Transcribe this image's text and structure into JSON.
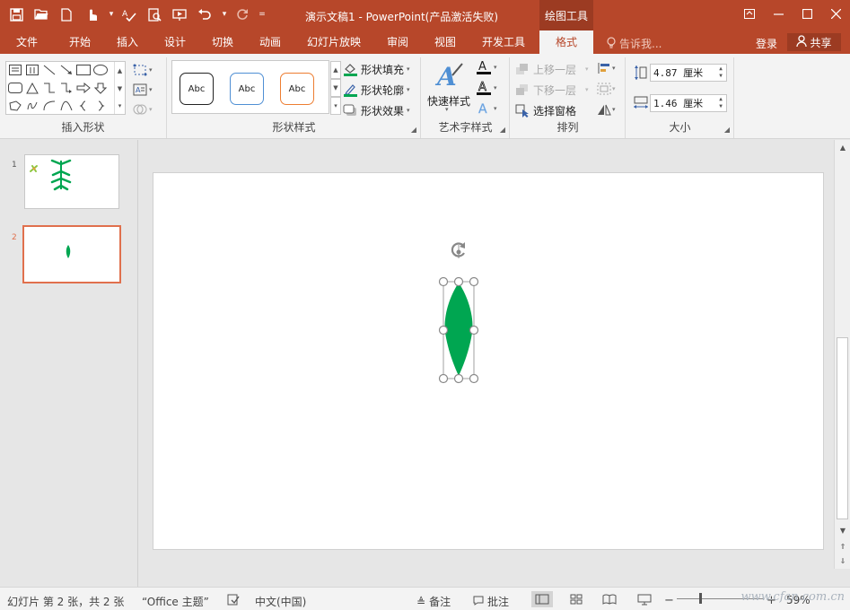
{
  "titlebar": {
    "doc_title": "演示文稿1 - PowerPoint(产品激活失败)",
    "context_tab": "绘图工具",
    "qat_icons": [
      "save-icon",
      "open-icon",
      "new-icon",
      "touch-mode-icon",
      "spelling-icon",
      "print-preview-icon",
      "slideshow-from-start-icon",
      "undo-icon",
      "redo-icon",
      "customize-qat-icon"
    ],
    "window_icons": [
      "ribbon-display-icon",
      "minimize-icon",
      "maximize-icon",
      "close-icon"
    ]
  },
  "tabs": [
    {
      "label": "文件"
    },
    {
      "label": "开始"
    },
    {
      "label": "插入"
    },
    {
      "label": "设计"
    },
    {
      "label": "切换"
    },
    {
      "label": "动画"
    },
    {
      "label": "幻灯片放映"
    },
    {
      "label": "审阅"
    },
    {
      "label": "视图"
    },
    {
      "label": "开发工具"
    },
    {
      "label": "格式",
      "active": true
    }
  ],
  "tell_me": "告诉我...",
  "login": "登录",
  "share": "共享",
  "ribbon": {
    "insert_shapes": {
      "label": "插入形状"
    },
    "shape_styles": {
      "label": "形状样式",
      "presets": [
        {
          "text": "Abc",
          "border": "#222222"
        },
        {
          "text": "Abc",
          "border": "#4f8fd4"
        },
        {
          "text": "Abc",
          "border": "#ed7d31"
        }
      ],
      "fill": "形状填充",
      "outline": "形状轮廓",
      "effects": "形状效果"
    },
    "wordart": {
      "label": "艺术字样式",
      "quick_styles": "快速样式"
    },
    "arrange": {
      "label": "排列",
      "bring_forward": "上移一层",
      "send_backward": "下移一层",
      "selection_pane": "选择窗格"
    },
    "size": {
      "label": "大小",
      "height": "4.87 厘米",
      "width": "1.46 厘米"
    }
  },
  "slides": [
    {
      "number": "1"
    },
    {
      "number": "2",
      "selected": true
    }
  ],
  "shape": {
    "fill": "#00a651",
    "type": "leaf"
  },
  "status": {
    "slide_info": "幻灯片 第 2 张，共 2 张",
    "theme": "“Office 主题”",
    "language": "中文(中国)",
    "notes": "备注",
    "comments": "批注",
    "zoom": "59%",
    "watermark": "www.cfan.com.cn"
  },
  "colors": {
    "accent": "#b7472a",
    "accent_dark": "#9c3b22",
    "selection": "#e0704d"
  }
}
